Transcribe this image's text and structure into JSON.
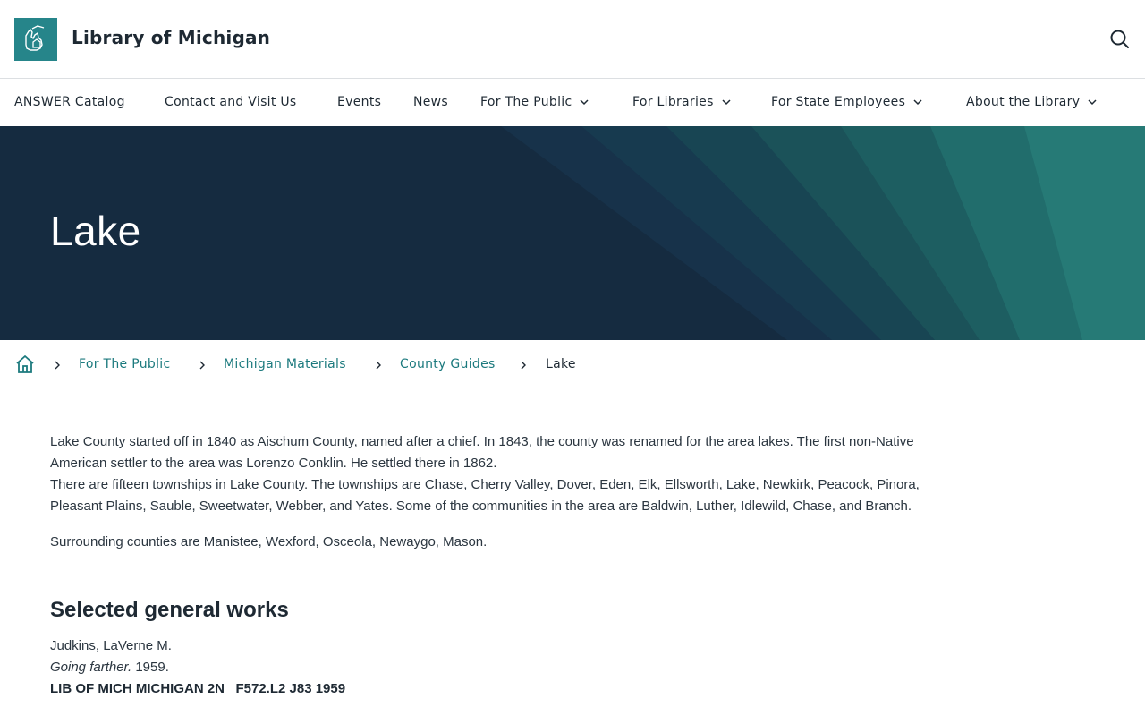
{
  "header": {
    "site_title": "Library of Michigan",
    "logo_icon": "michigan-library-logo-icon",
    "search_icon": "search-icon",
    "brand_color": "#26858a"
  },
  "nav": {
    "items": [
      {
        "label": "ANSWER Catalog",
        "has_dropdown": false
      },
      {
        "label": "Contact and Visit Us",
        "has_dropdown": false
      },
      {
        "label": "Events",
        "has_dropdown": false
      },
      {
        "label": "News",
        "has_dropdown": false
      },
      {
        "label": "For The Public",
        "has_dropdown": true
      },
      {
        "label": "For Libraries",
        "has_dropdown": true
      },
      {
        "label": "For State Employees",
        "has_dropdown": true
      },
      {
        "label": "About the Library",
        "has_dropdown": true
      }
    ]
  },
  "hero": {
    "title": "Lake",
    "background_color": "#152b40"
  },
  "breadcrumb": {
    "home_icon": "home-icon",
    "links": [
      "For The Public",
      "Michigan Materials",
      "County Guides"
    ],
    "current": "Lake",
    "link_color": "#1c7a7e"
  },
  "content": {
    "para1_line1": "Lake County started off in 1840 as Aischum County, named after a chief.  In 1843, the county was renamed for the area lakes.  The first non-Native",
    "para1_line2": "American settler to the area was Lorenzo Conklin.  He settled there in 1862.",
    "para1_line3": "There are fifteen townships in Lake County.  The townships are Chase, Cherry Valley, Dover, Eden, Elk, Ellsworth, Lake, Newkirk, Peacock, Pinora,",
    "para1_line4": "Pleasant Plains, Sauble, Sweetwater, Webber, and Yates.  Some of the communities in the area are Baldwin, Luther, Idlewild, Chase, and Branch.",
    "para2": "Surrounding counties are Manistee, Wexford, Osceola, Newaygo, Mason.",
    "section_heading": "Selected general works",
    "works": [
      {
        "author": "Judkins, LaVerne M.",
        "title": "Going farther.",
        "year": " 1959.",
        "call_number": "LIB OF MICH MICHIGAN 2N   F572.L2 J83 1959"
      }
    ]
  }
}
